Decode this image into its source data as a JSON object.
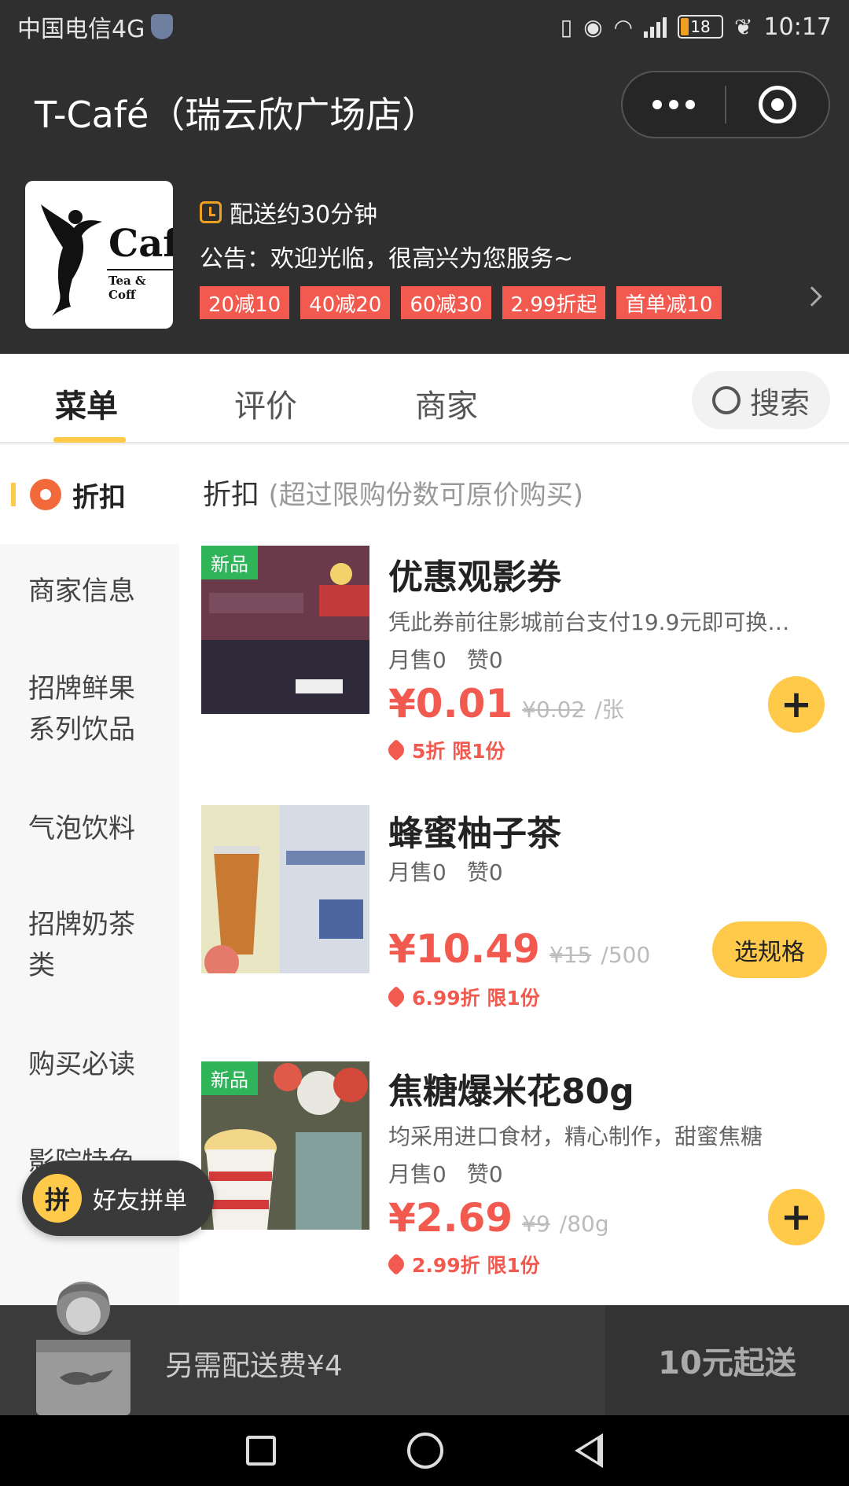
{
  "status_bar": {
    "carrier": "中国电信4G",
    "battery": "18",
    "battery_level_percent": 18,
    "network": "4G",
    "time": "10:17"
  },
  "header": {
    "shop_title": "T-Café（瑞云欣广场店）",
    "logo_text_main": "Caf",
    "logo_text_sub": "Tea & Coff",
    "delivery_time": "配送约30分钟",
    "notice": "公告：欢迎光临，很高兴为您服务~",
    "promos": [
      "20减10",
      "40减20",
      "60减30",
      "2.99折起",
      "首单减10"
    ]
  },
  "tabs": {
    "items": [
      "菜单",
      "评价",
      "商家"
    ],
    "active": "菜单",
    "search_label": "搜索"
  },
  "sidebar": {
    "active": "折扣",
    "items": [
      "商家信息",
      "招牌鲜果系列饮品",
      "气泡饮料",
      "招牌奶茶类",
      "购买必读",
      "影院特色"
    ]
  },
  "section": {
    "title": "折扣",
    "subtitle": "(超过限购份数可原价购买)"
  },
  "products": [
    {
      "name": "优惠观影券",
      "desc": "凭此券前往影城前台支付19.9元即可换…",
      "sales": "月售0",
      "likes": "赞0",
      "price": "¥0.01",
      "orig_price": "¥0.02",
      "unit": "/张",
      "discount": "5折 限1份",
      "tag": "新品",
      "action": "+"
    },
    {
      "name": "蜂蜜柚子茶",
      "desc": "",
      "sales": "月售0",
      "likes": "赞0",
      "price": "¥10.49",
      "orig_price": "¥15",
      "unit": "/500",
      "discount": "6.99折 限1份",
      "tag": "",
      "action": "选规格"
    },
    {
      "name": "焦糖爆米花80g",
      "desc": "均采用进口食材，精心制作，甜蜜焦糖",
      "sales": "月售0",
      "likes": "赞0",
      "price": "¥2.69",
      "orig_price": "¥9",
      "unit": "/80g",
      "discount": "2.99折 限1份",
      "tag": "新品",
      "action": "+"
    }
  ],
  "group_order": {
    "icon_char": "拼",
    "label": "好友拼单"
  },
  "bottom_bar": {
    "delivery_fee": "另需配送费¥4",
    "min_order": "10元起送"
  },
  "colors": {
    "accent_yellow": "#ffc94a",
    "price_red": "#f25a4f",
    "header_dark": "#2f2f2f"
  },
  "icons": [
    "shield-icon",
    "vibrate-icon",
    "eye-icon",
    "wifi-icon",
    "signal-icon",
    "battery-icon",
    "leaf-icon",
    "more-dots-icon",
    "close-target-icon",
    "clock-icon",
    "chevron-right-icon",
    "search-icon",
    "discount-badge-icon",
    "tag-icon",
    "plus-icon",
    "home-square-icon",
    "home-circle-icon",
    "back-triangle-icon"
  ]
}
